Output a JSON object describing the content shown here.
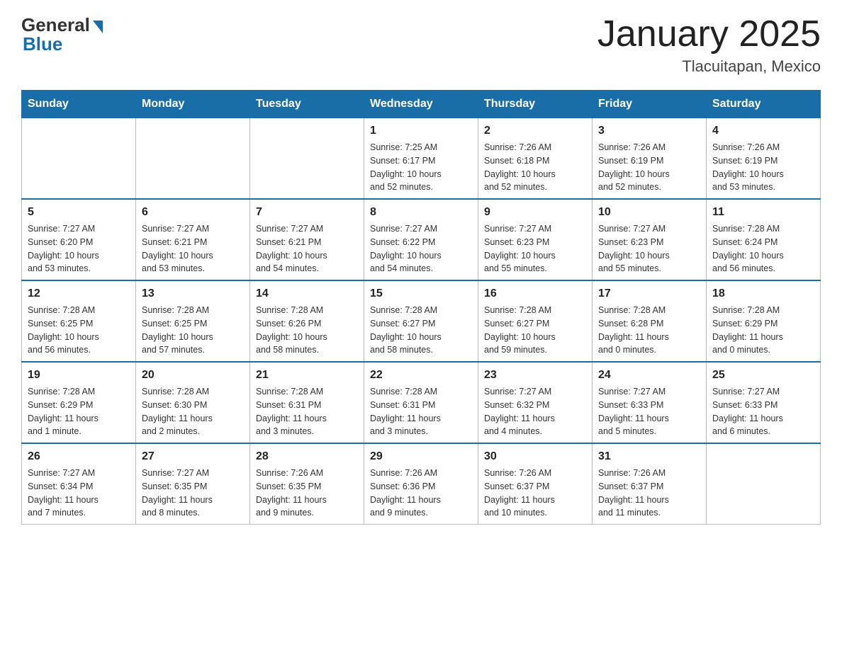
{
  "header": {
    "logo_general": "General",
    "logo_blue": "Blue",
    "title": "January 2025",
    "subtitle": "Tlacuitapan, Mexico"
  },
  "days_of_week": [
    "Sunday",
    "Monday",
    "Tuesday",
    "Wednesday",
    "Thursday",
    "Friday",
    "Saturday"
  ],
  "weeks": [
    [
      {
        "day": "",
        "info": ""
      },
      {
        "day": "",
        "info": ""
      },
      {
        "day": "",
        "info": ""
      },
      {
        "day": "1",
        "info": "Sunrise: 7:25 AM\nSunset: 6:17 PM\nDaylight: 10 hours\nand 52 minutes."
      },
      {
        "day": "2",
        "info": "Sunrise: 7:26 AM\nSunset: 6:18 PM\nDaylight: 10 hours\nand 52 minutes."
      },
      {
        "day": "3",
        "info": "Sunrise: 7:26 AM\nSunset: 6:19 PM\nDaylight: 10 hours\nand 52 minutes."
      },
      {
        "day": "4",
        "info": "Sunrise: 7:26 AM\nSunset: 6:19 PM\nDaylight: 10 hours\nand 53 minutes."
      }
    ],
    [
      {
        "day": "5",
        "info": "Sunrise: 7:27 AM\nSunset: 6:20 PM\nDaylight: 10 hours\nand 53 minutes."
      },
      {
        "day": "6",
        "info": "Sunrise: 7:27 AM\nSunset: 6:21 PM\nDaylight: 10 hours\nand 53 minutes."
      },
      {
        "day": "7",
        "info": "Sunrise: 7:27 AM\nSunset: 6:21 PM\nDaylight: 10 hours\nand 54 minutes."
      },
      {
        "day": "8",
        "info": "Sunrise: 7:27 AM\nSunset: 6:22 PM\nDaylight: 10 hours\nand 54 minutes."
      },
      {
        "day": "9",
        "info": "Sunrise: 7:27 AM\nSunset: 6:23 PM\nDaylight: 10 hours\nand 55 minutes."
      },
      {
        "day": "10",
        "info": "Sunrise: 7:27 AM\nSunset: 6:23 PM\nDaylight: 10 hours\nand 55 minutes."
      },
      {
        "day": "11",
        "info": "Sunrise: 7:28 AM\nSunset: 6:24 PM\nDaylight: 10 hours\nand 56 minutes."
      }
    ],
    [
      {
        "day": "12",
        "info": "Sunrise: 7:28 AM\nSunset: 6:25 PM\nDaylight: 10 hours\nand 56 minutes."
      },
      {
        "day": "13",
        "info": "Sunrise: 7:28 AM\nSunset: 6:25 PM\nDaylight: 10 hours\nand 57 minutes."
      },
      {
        "day": "14",
        "info": "Sunrise: 7:28 AM\nSunset: 6:26 PM\nDaylight: 10 hours\nand 58 minutes."
      },
      {
        "day": "15",
        "info": "Sunrise: 7:28 AM\nSunset: 6:27 PM\nDaylight: 10 hours\nand 58 minutes."
      },
      {
        "day": "16",
        "info": "Sunrise: 7:28 AM\nSunset: 6:27 PM\nDaylight: 10 hours\nand 59 minutes."
      },
      {
        "day": "17",
        "info": "Sunrise: 7:28 AM\nSunset: 6:28 PM\nDaylight: 11 hours\nand 0 minutes."
      },
      {
        "day": "18",
        "info": "Sunrise: 7:28 AM\nSunset: 6:29 PM\nDaylight: 11 hours\nand 0 minutes."
      }
    ],
    [
      {
        "day": "19",
        "info": "Sunrise: 7:28 AM\nSunset: 6:29 PM\nDaylight: 11 hours\nand 1 minute."
      },
      {
        "day": "20",
        "info": "Sunrise: 7:28 AM\nSunset: 6:30 PM\nDaylight: 11 hours\nand 2 minutes."
      },
      {
        "day": "21",
        "info": "Sunrise: 7:28 AM\nSunset: 6:31 PM\nDaylight: 11 hours\nand 3 minutes."
      },
      {
        "day": "22",
        "info": "Sunrise: 7:28 AM\nSunset: 6:31 PM\nDaylight: 11 hours\nand 3 minutes."
      },
      {
        "day": "23",
        "info": "Sunrise: 7:27 AM\nSunset: 6:32 PM\nDaylight: 11 hours\nand 4 minutes."
      },
      {
        "day": "24",
        "info": "Sunrise: 7:27 AM\nSunset: 6:33 PM\nDaylight: 11 hours\nand 5 minutes."
      },
      {
        "day": "25",
        "info": "Sunrise: 7:27 AM\nSunset: 6:33 PM\nDaylight: 11 hours\nand 6 minutes."
      }
    ],
    [
      {
        "day": "26",
        "info": "Sunrise: 7:27 AM\nSunset: 6:34 PM\nDaylight: 11 hours\nand 7 minutes."
      },
      {
        "day": "27",
        "info": "Sunrise: 7:27 AM\nSunset: 6:35 PM\nDaylight: 11 hours\nand 8 minutes."
      },
      {
        "day": "28",
        "info": "Sunrise: 7:26 AM\nSunset: 6:35 PM\nDaylight: 11 hours\nand 9 minutes."
      },
      {
        "day": "29",
        "info": "Sunrise: 7:26 AM\nSunset: 6:36 PM\nDaylight: 11 hours\nand 9 minutes."
      },
      {
        "day": "30",
        "info": "Sunrise: 7:26 AM\nSunset: 6:37 PM\nDaylight: 11 hours\nand 10 minutes."
      },
      {
        "day": "31",
        "info": "Sunrise: 7:26 AM\nSunset: 6:37 PM\nDaylight: 11 hours\nand 11 minutes."
      },
      {
        "day": "",
        "info": ""
      }
    ]
  ]
}
